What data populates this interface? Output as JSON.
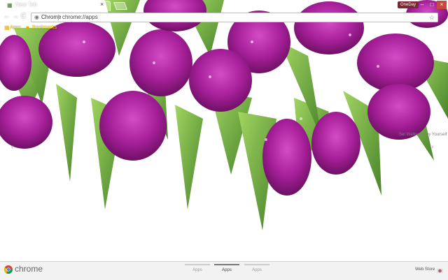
{
  "window": {
    "tab_title": "New Tab",
    "tab_close": "×",
    "profile_name": "OneDay",
    "min": "–",
    "max": "□",
    "close": "×"
  },
  "toolbar": {
    "back": "←",
    "forward": "→",
    "reload": "C",
    "omnibox_label": "Chrome",
    "omnibox_url": "chrome://apps",
    "star": "☆"
  },
  "bookmarks": {
    "apps_label": "Apps",
    "folder_label": "Bookmarks"
  },
  "page": {
    "customize_link": "Set Wallpaper by Yourself",
    "arrow_left": "‹",
    "arrow_right": "›"
  },
  "launcher": {
    "brand": "chrome",
    "pages": [
      {
        "label": "Apps"
      },
      {
        "label": "Apps"
      },
      {
        "label": "Apps"
      }
    ],
    "webstore_label": "Web Store"
  },
  "colors": {
    "tulip": "#b0269f",
    "leaf": "#5a9a2a",
    "background": "#ffffff",
    "bar": "#f2f2f2"
  }
}
